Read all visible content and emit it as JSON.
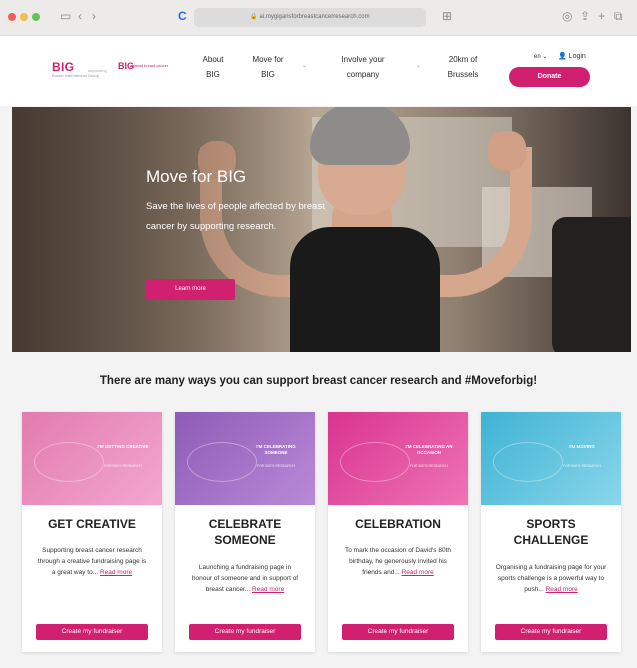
{
  "browser": {
    "url": "ai.mygigansforbreastcancerresearch.com",
    "colors": {
      "close": "#ee5f57",
      "minimize": "#f5bd4f",
      "maximize": "#61c454"
    }
  },
  "header": {
    "logo": {
      "name": "BIG",
      "tagline": "Breast International Group",
      "support_text": "supporting",
      "partner_name": "BIG",
      "partner_tagline": "against breast cancer"
    },
    "nav": [
      {
        "line1": "About",
        "line2": "BIG"
      },
      {
        "line1": "Move for",
        "line2": "BIG"
      },
      {
        "line1": "Involve your",
        "line2": "company"
      },
      {
        "line1": "20km of",
        "line2": "Brussels"
      }
    ],
    "lang": "en",
    "login": "Login",
    "donate": "Donate",
    "accent": "#d1206f"
  },
  "hero": {
    "title": "Move for BIG",
    "text": "Save the lives of people affected by breast cancer by supporting research.",
    "button": "Learn more"
  },
  "section": {
    "title": "There are many ways you can support breast cancer research and #Moveforbig!"
  },
  "cards": [
    {
      "tag": "I'M GETTING CREATIVE",
      "tag_sub": "FOR BIG'S RESEARCH",
      "title_line1": "GET CREATIVE",
      "title_line2": "",
      "text": "Supporting breast cancer research through a creative fundraising page is a great way to...",
      "more": "Read more",
      "button": "Create my fundraiser",
      "color1": "#e27bb0",
      "color2": "#f2a7cf"
    },
    {
      "tag": "I'M CELEBRATING SOMEONE",
      "tag_sub": "FOR BIG'S RESEARCH",
      "title_line1": "CELEBRATE",
      "title_line2": "SOMEONE",
      "text": "Launching a fundraising page in honour of someone and in support of breast cancer...",
      "more": "Read more",
      "button": "Create my fundraiser",
      "color1": "#8e5bb6",
      "color2": "#b98ad8"
    },
    {
      "tag": "I'M CELEBRATING AN OCCASION",
      "tag_sub": "FOR BIG'S RESEARCH",
      "title_line1": "CELEBRATION",
      "title_line2": "",
      "text": "To mark the occasion of David's 80th birthday, he generously invited his friends and...",
      "more": "Read more",
      "button": "Create my fundraiser",
      "color1": "#d9348f",
      "color2": "#ee74b5"
    },
    {
      "tag": "I'M MOVING",
      "tag_sub": "FOR BIG'S RESEARCH",
      "title_line1": "SPORTS",
      "title_line2": "CHALLENGE",
      "text": "Organising a fundraising page for your sports challenge is a powerful way to push...",
      "more": "Read more",
      "button": "Create my fundraiser",
      "color1": "#3eb3d3",
      "color2": "#8ad6ea"
    }
  ]
}
